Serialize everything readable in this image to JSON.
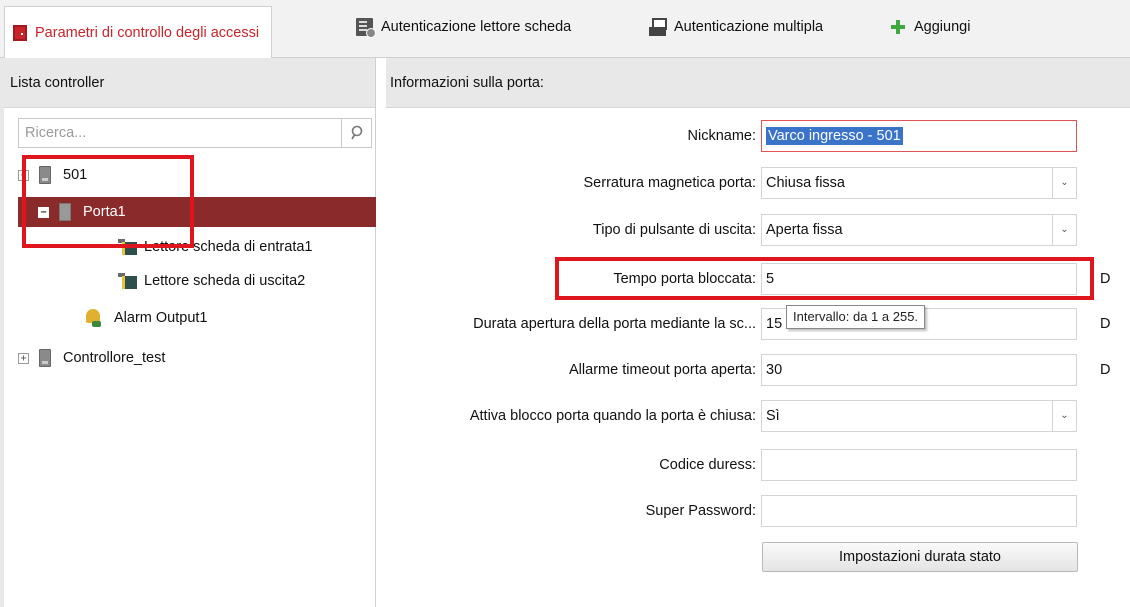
{
  "tabs": [
    {
      "label": "Parametri di controllo degli accessi",
      "icon": "door-icon",
      "active": true
    },
    {
      "label": "Autenticazione lettore scheda",
      "icon": "card-reader-icon"
    },
    {
      "label": "Autenticazione multipla",
      "icon": "multi-auth-icon"
    },
    {
      "label": "Aggiungi",
      "icon": "plus-icon"
    }
  ],
  "left_panel": {
    "title": "Lista controller",
    "search_placeholder": "Ricerca...",
    "search_icon": "search-icon",
    "tree": [
      {
        "label": "501",
        "expander": "−",
        "icon": "controller-icon"
      },
      {
        "label": "Porta1",
        "expander": "−",
        "icon": "door-icon",
        "selected": true
      },
      {
        "label": "Lettore scheda di entrata1",
        "icon": "card-reader-icon"
      },
      {
        "label": "Lettore scheda di uscita2",
        "icon": "card-reader-icon"
      },
      {
        "label": "Alarm Output1",
        "icon": "alarm-output-icon"
      },
      {
        "label": "Controllore_test",
        "expander": "+",
        "icon": "controller-icon"
      }
    ]
  },
  "right_panel": {
    "title": "Informazioni sulla porta:",
    "fields": [
      {
        "label": "Nickname:",
        "value": "Varco ingresso - 501"
      },
      {
        "label": "Serratura magnetica porta:",
        "value": "Chiusa fissa"
      },
      {
        "label": "Tipo di pulsante di uscita:",
        "value": "Aperta fissa"
      },
      {
        "label": "Tempo porta bloccata:",
        "value": "5",
        "unit": "D"
      },
      {
        "label": "Durata apertura della porta mediante la sc...",
        "value": "15",
        "unit": "D"
      },
      {
        "label": "Allarme timeout porta aperta:",
        "value": "30",
        "unit": "D"
      },
      {
        "label": "Attiva blocco porta quando la porta è chiusa:",
        "value": "Sì"
      },
      {
        "label": "Codice duress:",
        "value": ""
      },
      {
        "label": "Super Password:",
        "value": ""
      }
    ],
    "button_label": "Impostazioni durata stato",
    "tooltip": "Intervallo: da 1 a 255.",
    "dropdown_glyph": "⌄"
  },
  "colors": {
    "accent": "#c8242a",
    "selected_row": "#8a2a2a",
    "highlight_frame": "#e0161e",
    "add_green": "#3ea93e"
  }
}
